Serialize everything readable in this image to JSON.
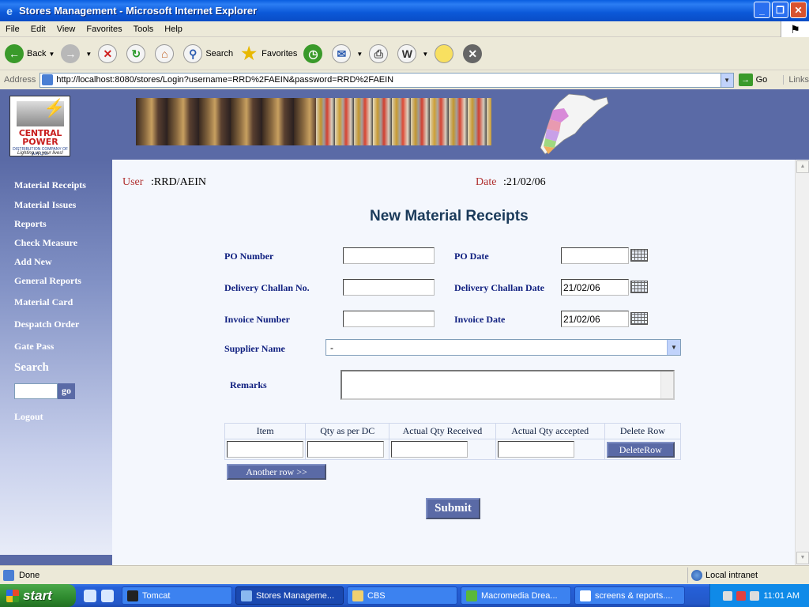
{
  "window": {
    "title": "Stores Management - Microsoft Internet Explorer"
  },
  "menu": [
    "File",
    "Edit",
    "View",
    "Favorites",
    "Tools",
    "Help"
  ],
  "toolbar": {
    "back": "Back",
    "search": "Search",
    "favorites": "Favorites"
  },
  "address": {
    "label": "Address",
    "url": "http://localhost:8080/stores/Login?username=RRD%2FAEIN&password=RRD%2FAEIN",
    "go": "Go",
    "links": "Links"
  },
  "logo": {
    "line1": "CENTRAL",
    "line2": "POWER",
    "line3": "DISTRIBUTION COMPANY OF A.P. LTD.",
    "line4": "Lighting up your lives!"
  },
  "sidebar": {
    "items": [
      "Material Receipts",
      "Material Issues",
      "Reports",
      "Check Measure",
      "Add New",
      "General Reports",
      "Material Card",
      "Despatch Order",
      "Gate Pass"
    ],
    "search_title": "Search",
    "go_label": "go",
    "logout": "Logout"
  },
  "header": {
    "user_label": "User",
    "user_value": ":RRD/AEIN",
    "date_label": "Date",
    "date_value": ":21/02/06"
  },
  "form": {
    "title": "New Material Receipts",
    "po_number_label": "PO Number",
    "po_date_label": "PO Date",
    "dc_no_label": "Delivery Challan No.",
    "dc_date_label": "Delivery Challan Date",
    "dc_date_value": "21/02/06",
    "invoice_number_label": "Invoice Number",
    "invoice_date_label": "Invoice Date",
    "invoice_date_value": "21/02/06",
    "supplier_label": "Supplier Name",
    "supplier_value": "-",
    "remarks_label": "Remarks"
  },
  "grid": {
    "headers": [
      "Item",
      "Qty as per DC",
      "Actual Qty Received",
      "Actual Qty accepted",
      "Delete Row"
    ],
    "delete_button": "DeleteRow",
    "another_row": "Another row >>",
    "submit": "Submit"
  },
  "status": {
    "text": "Done",
    "zone": "Local intranet"
  },
  "taskbar": {
    "start": "start",
    "tasks": [
      "Tomcat",
      "Stores Manageme...",
      "CBS",
      "Macromedia Drea...",
      "screens & reports...."
    ],
    "clock": "11:01 AM"
  }
}
